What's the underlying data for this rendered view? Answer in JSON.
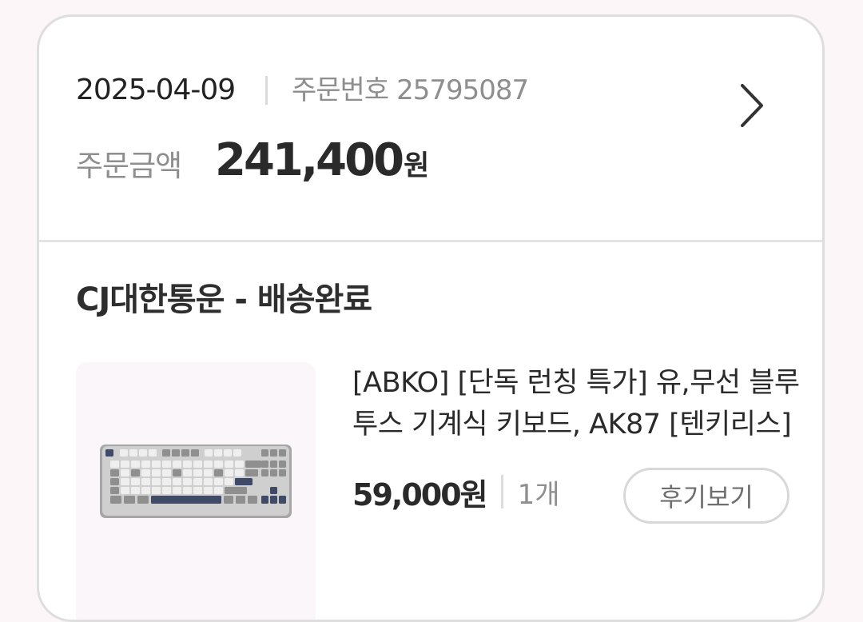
{
  "order": {
    "date": "2025-04-09",
    "number_label": "주문번호",
    "number": "25795087",
    "amount_label": "주문금액",
    "amount": "241,400",
    "amount_unit": "원"
  },
  "shipment": {
    "carrier_status": "CJ대한통운 - 배송완료"
  },
  "product": {
    "title": "[ABKO] [단독 런칭 특가] 유,무선 블루투스 기계식 키보드, AK87 [텐키리스]",
    "price": "59,000원",
    "quantity": "1개",
    "review_button_label": "후기보기"
  },
  "icons": {
    "detail": "chevron-right-icon",
    "product_image": "keyboard-product-image"
  },
  "colors": {
    "background": "#fcf6f9",
    "card": "#ffffff",
    "border": "#dedede",
    "primary_text": "#2a2a2a",
    "secondary_text": "#8e8e8e",
    "keyboard_accent": "#3f4a66"
  }
}
